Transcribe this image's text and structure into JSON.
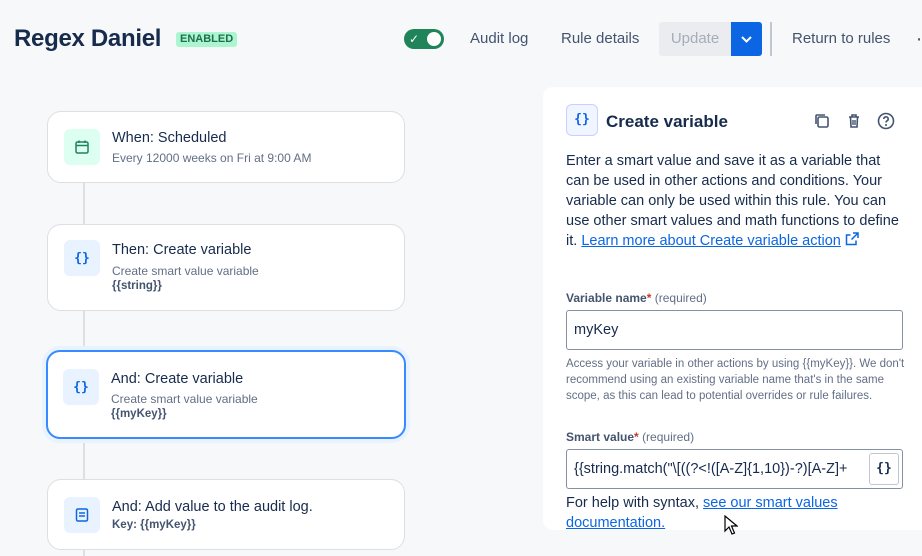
{
  "header": {
    "title": "Regex Daniel",
    "status_badge": "ENABLED",
    "toggle_on": true,
    "audit_log": "Audit log",
    "rule_details": "Rule details",
    "update": "Update",
    "return_to_rules": "Return to rules",
    "more": "⋯"
  },
  "flow": {
    "steps": [
      {
        "icon": "calendar-icon",
        "title": "When: Scheduled",
        "subtitle": "Every 12000 weeks on Fri at 9:00 AM",
        "detail": ""
      },
      {
        "icon": "braces-icon",
        "title": "Then: Create variable",
        "subtitle": "Create smart value variable",
        "detail": "{{string}}"
      },
      {
        "icon": "braces-icon",
        "title": "And: Create variable",
        "subtitle": "Create smart value variable",
        "detail": "{{myKey}}",
        "selected": true
      },
      {
        "icon": "audit-log-icon",
        "title": "And: Add value to the audit log.",
        "subtitle": "",
        "detail": "Key: {{myKey}}"
      }
    ]
  },
  "panel": {
    "icon_text": "{}",
    "title": "Create variable",
    "description": "Enter a smart value and save it as a variable that can be used in other actions and conditions. Your variable can only be used within this rule. You can use other smart values and math functions to define it.",
    "learn_more_link": "Learn more about Create variable action",
    "variable_name_label": "Variable name",
    "required_marker": "*",
    "required_text": "(required)",
    "variable_name_value": "myKey",
    "variable_help": "Access your variable in other actions by using {{myKey}}. We don't recommend using an existing variable name that's in the same scope, as this can lead to potential overrides or rule failures.",
    "smart_value_label": "Smart value",
    "smart_value_value": "{{string.match(\"\\[((?<!([A-Z]{1,10})-?)[A-Z]+",
    "smart_value_button": "{}",
    "syntax_help_prefix": "For help with syntax, ",
    "syntax_help_link": "see our smart values documentation."
  },
  "colors": {
    "accent": "#0c66e4",
    "toggle_green": "#1f845a",
    "badge_bg": "#abf5d1",
    "selected_border": "#388bff"
  }
}
